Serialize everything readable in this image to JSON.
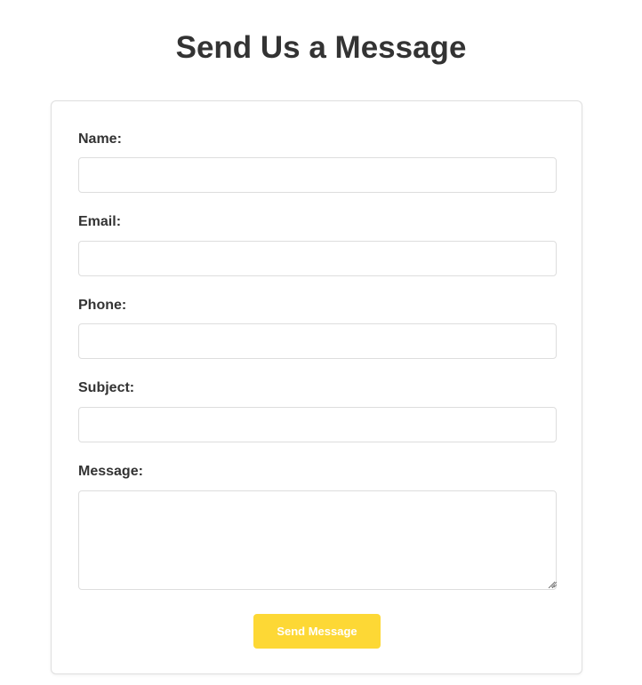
{
  "page": {
    "title": "Send Us a Message"
  },
  "form": {
    "fields": [
      {
        "label": "Name:",
        "value": ""
      },
      {
        "label": "Email:",
        "value": ""
      },
      {
        "label": "Phone:",
        "value": ""
      },
      {
        "label": "Subject:",
        "value": ""
      }
    ],
    "message": {
      "label": "Message:",
      "value": ""
    },
    "submit_label": "Send Message"
  },
  "colors": {
    "button_background": "#fdd835",
    "button_text": "#ffffff",
    "text": "#333333",
    "border": "#dddddd"
  }
}
